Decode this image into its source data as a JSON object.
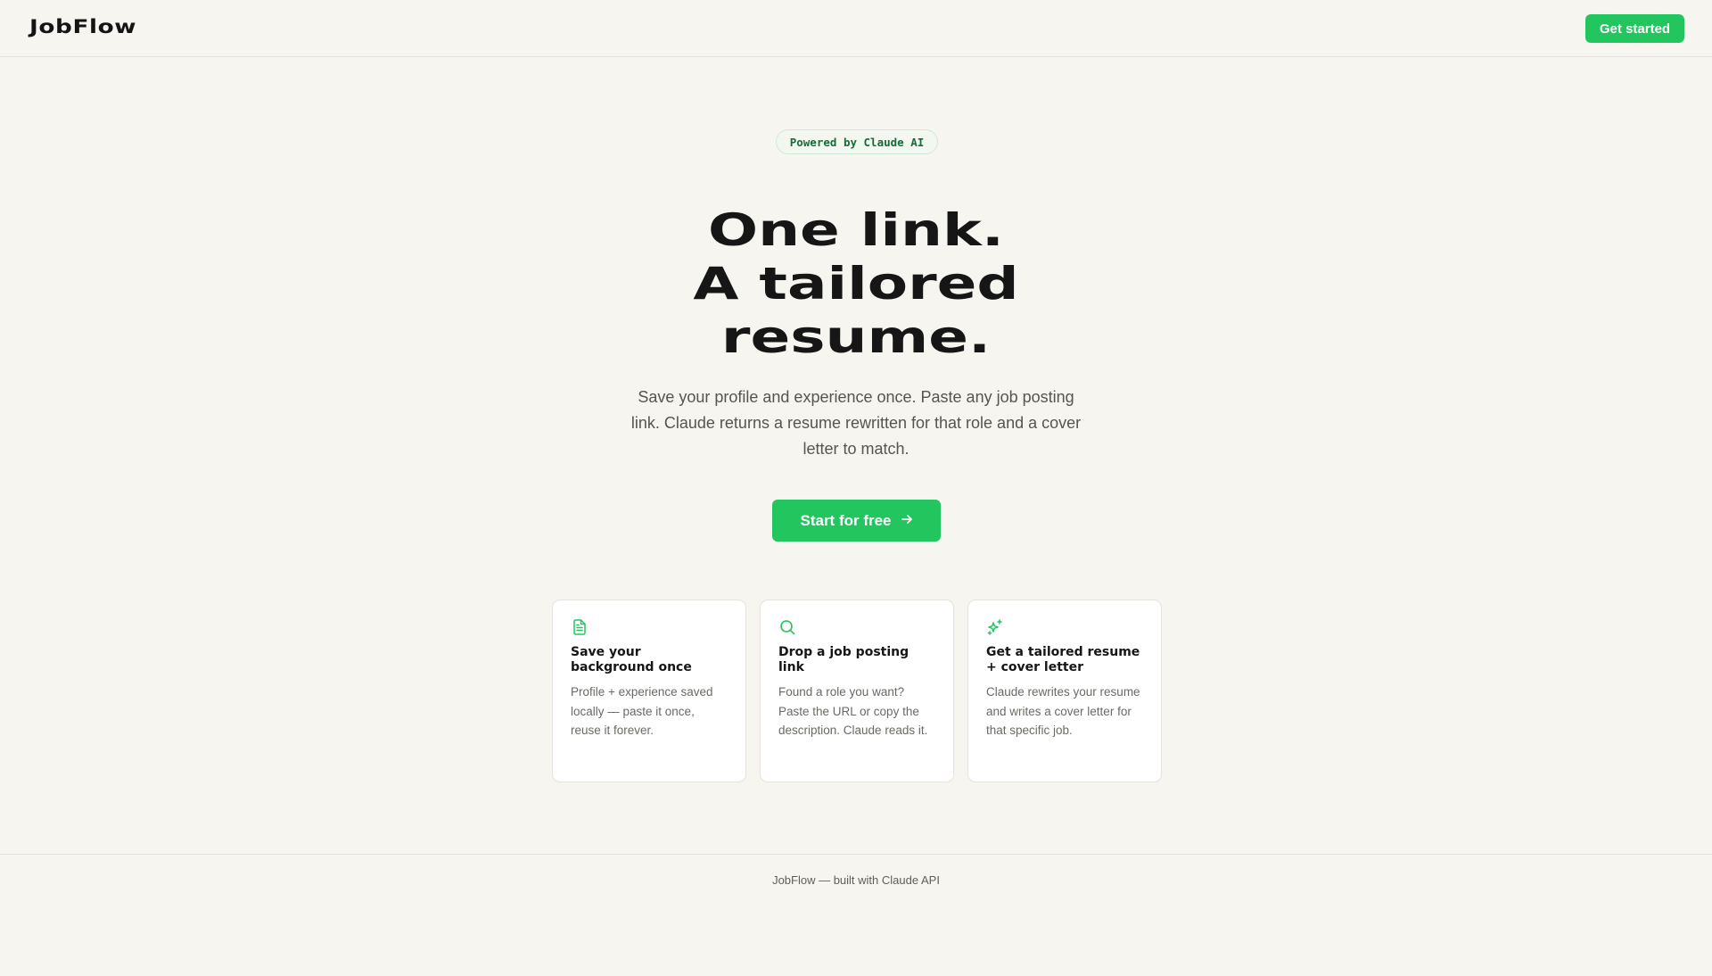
{
  "header": {
    "logo": "JobFlow",
    "get_started_label": "Get started"
  },
  "hero": {
    "badge": "Powered by Claude AI",
    "title_lines": [
      "One link.",
      "A tailored",
      "resume."
    ],
    "subtitle": "Save your profile and experience once. Paste any job posting link. Claude returns a resume rewritten for that role and a cover letter to match.",
    "cta_label": "Start for free",
    "cta_icon": "arrow-right-icon"
  },
  "features": [
    {
      "icon": "document-icon",
      "title": "Save your background once",
      "description": "Profile + experience saved locally — paste it once, reuse it forever."
    },
    {
      "icon": "search-icon",
      "title": "Drop a job posting link",
      "description": "Found a role you want? Paste the URL or copy the description. Claude reads it."
    },
    {
      "icon": "sparkles-icon",
      "title": "Get a tailored resume + cover letter",
      "description": "Claude rewrites your resume and writes a cover letter for that specific job."
    }
  ],
  "footer": {
    "text": "JobFlow — built with Claude API"
  },
  "colors": {
    "accent": "#22c55e",
    "background": "#f7f5ef",
    "text": "#161616"
  }
}
